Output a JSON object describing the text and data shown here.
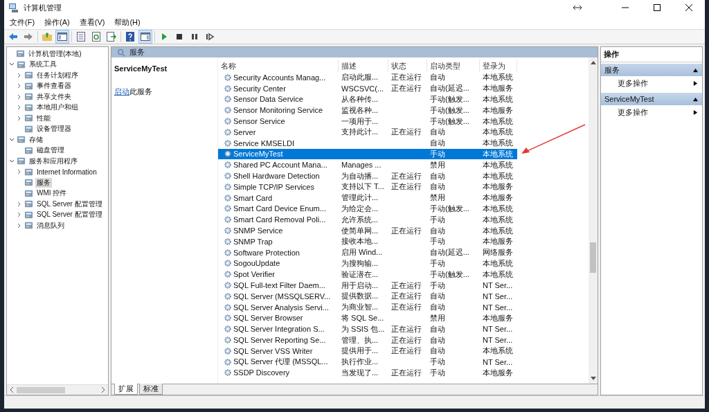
{
  "window": {
    "title": "计算机管理"
  },
  "menu": [
    "文件(F)",
    "操作(A)",
    "查看(V)",
    "帮助(H)"
  ],
  "tree": [
    {
      "label": "计算机管理(本地)",
      "selected": false,
      "children": [
        {
          "label": "系统工具",
          "selected": false,
          "expanded": true,
          "children": [
            {
              "label": "任务计划程序",
              "selected": false,
              "expanded": false
            },
            {
              "label": "事件查看器",
              "selected": false,
              "expanded": false
            },
            {
              "label": "共享文件夹",
              "selected": false,
              "expanded": false
            },
            {
              "label": "本地用户和组",
              "selected": false,
              "expanded": false
            },
            {
              "label": "性能",
              "selected": false,
              "expanded": false
            },
            {
              "label": "设备管理器",
              "selected": false
            }
          ]
        },
        {
          "label": "存储",
          "selected": false,
          "expanded": true,
          "children": [
            {
              "label": "磁盘管理",
              "selected": false
            }
          ]
        },
        {
          "label": "服务和应用程序",
          "selected": false,
          "expanded": true,
          "children": [
            {
              "label": "Internet Information",
              "selected": false,
              "expanded": false
            },
            {
              "label": "服务",
              "selected": true
            },
            {
              "label": "WMI 控件",
              "selected": false
            },
            {
              "label": "SQL Server 配置管理",
              "selected": false,
              "expanded": false
            },
            {
              "label": "SQL Server 配置管理",
              "selected": false,
              "expanded": false
            },
            {
              "label": "消息队列",
              "selected": false,
              "expanded": false
            }
          ]
        }
      ]
    }
  ],
  "panel_title": "服务",
  "details": {
    "title": "ServiceMyTest",
    "link": "启动",
    "text": "此服务"
  },
  "table": {
    "columns": [
      "名称",
      "描述",
      "状态",
      "启动类型",
      "登录为"
    ],
    "rows": [
      {
        "name": "Security Accounts Manag...",
        "description": "启动此服...",
        "status": "正在运行",
        "startup": "自动",
        "logon": "本地系统",
        "selected": false
      },
      {
        "name": "Security Center",
        "description": "WSCSVC(...",
        "status": "正在运行",
        "startup": "自动(延迟...",
        "logon": "本地服务",
        "selected": false
      },
      {
        "name": "Sensor Data Service",
        "description": "从各种传...",
        "status": "",
        "startup": "手动(触发...",
        "logon": "本地系统",
        "selected": false
      },
      {
        "name": "Sensor Monitoring Service",
        "description": "监视各种...",
        "status": "",
        "startup": "手动(触发...",
        "logon": "本地服务",
        "selected": false
      },
      {
        "name": "Sensor Service",
        "description": "一项用于...",
        "status": "",
        "startup": "手动(触发...",
        "logon": "本地系统",
        "selected": false
      },
      {
        "name": "Server",
        "description": "支持此计...",
        "status": "正在运行",
        "startup": "自动",
        "logon": "本地系统",
        "selected": false
      },
      {
        "name": "Service KMSELDI",
        "description": "",
        "status": "",
        "startup": "自动",
        "logon": "本地系统",
        "selected": false
      },
      {
        "name": "ServiceMyTest",
        "description": "",
        "status": "",
        "startup": "手动",
        "logon": "本地系统",
        "selected": true
      },
      {
        "name": "Shared PC Account Mana...",
        "description": "Manages ...",
        "status": "",
        "startup": "禁用",
        "logon": "本地系统",
        "selected": false
      },
      {
        "name": "Shell Hardware Detection",
        "description": "为自动播...",
        "status": "正在运行",
        "startup": "自动",
        "logon": "本地系统",
        "selected": false
      },
      {
        "name": "Simple TCP/IP Services",
        "description": "支持以下 T...",
        "status": "正在运行",
        "startup": "自动",
        "logon": "本地服务",
        "selected": false
      },
      {
        "name": "Smart Card",
        "description": "管理此计...",
        "status": "",
        "startup": "禁用",
        "logon": "本地服务",
        "selected": false
      },
      {
        "name": "Smart Card Device Enum...",
        "description": "为给定会...",
        "status": "",
        "startup": "手动(触发...",
        "logon": "本地系统",
        "selected": false
      },
      {
        "name": "Smart Card Removal Poli...",
        "description": "允许系统...",
        "status": "",
        "startup": "手动",
        "logon": "本地系统",
        "selected": false
      },
      {
        "name": "SNMP Service",
        "description": "使简单网...",
        "status": "正在运行",
        "startup": "自动",
        "logon": "本地系统",
        "selected": false
      },
      {
        "name": "SNMP Trap",
        "description": "接收本地...",
        "status": "",
        "startup": "手动",
        "logon": "本地服务",
        "selected": false
      },
      {
        "name": "Software Protection",
        "description": "启用 Wind...",
        "status": "",
        "startup": "自动(延迟...",
        "logon": "网络服务",
        "selected": false
      },
      {
        "name": "SogouUpdate",
        "description": "为搜狗输...",
        "status": "",
        "startup": "手动",
        "logon": "本地系统",
        "selected": false
      },
      {
        "name": "Spot Verifier",
        "description": "验证潜在...",
        "status": "",
        "startup": "手动(触发...",
        "logon": "本地系统",
        "selected": false
      },
      {
        "name": "SQL Full-text Filter Daem...",
        "description": "用于启动...",
        "status": "正在运行",
        "startup": "手动",
        "logon": "NT Ser...",
        "selected": false
      },
      {
        "name": "SQL Server (MSSQLSERV...",
        "description": "提供数据...",
        "status": "正在运行",
        "startup": "自动",
        "logon": "NT Ser...",
        "selected": false
      },
      {
        "name": "SQL Server Analysis Servi...",
        "description": "为商业智...",
        "status": "正在运行",
        "startup": "自动",
        "logon": "NT Ser...",
        "selected": false
      },
      {
        "name": "SQL Server Browser",
        "description": "将 SQL Se...",
        "status": "",
        "startup": "禁用",
        "logon": "本地服务",
        "selected": false
      },
      {
        "name": "SQL Server Integration S...",
        "description": "为 SSIS 包...",
        "status": "正在运行",
        "startup": "自动",
        "logon": "NT Ser...",
        "selected": false
      },
      {
        "name": "SQL Server Reporting Se...",
        "description": "管理、执...",
        "status": "正在运行",
        "startup": "自动",
        "logon": "NT Ser...",
        "selected": false
      },
      {
        "name": "SQL Server VSS Writer",
        "description": "提供用于...",
        "status": "正在运行",
        "startup": "自动",
        "logon": "本地系统",
        "selected": false
      },
      {
        "name": "SQL Server 代理 (MSSQL...",
        "description": "执行作业...",
        "status": "",
        "startup": "手动",
        "logon": "NT Ser...",
        "selected": false
      },
      {
        "name": "SSDP Discovery",
        "description": "当发现了...",
        "status": "正在运行",
        "startup": "手动",
        "logon": "本地服务",
        "selected": false
      }
    ]
  },
  "bottom_tabs": [
    {
      "label": "扩展",
      "selected": true
    },
    {
      "label": "标准",
      "selected": false
    }
  ],
  "actions": {
    "title": "操作",
    "sections": [
      {
        "title": "服务",
        "items": [
          "更多操作"
        ]
      },
      {
        "title": "ServiceMyTest",
        "items": [
          "更多操作"
        ]
      }
    ]
  }
}
